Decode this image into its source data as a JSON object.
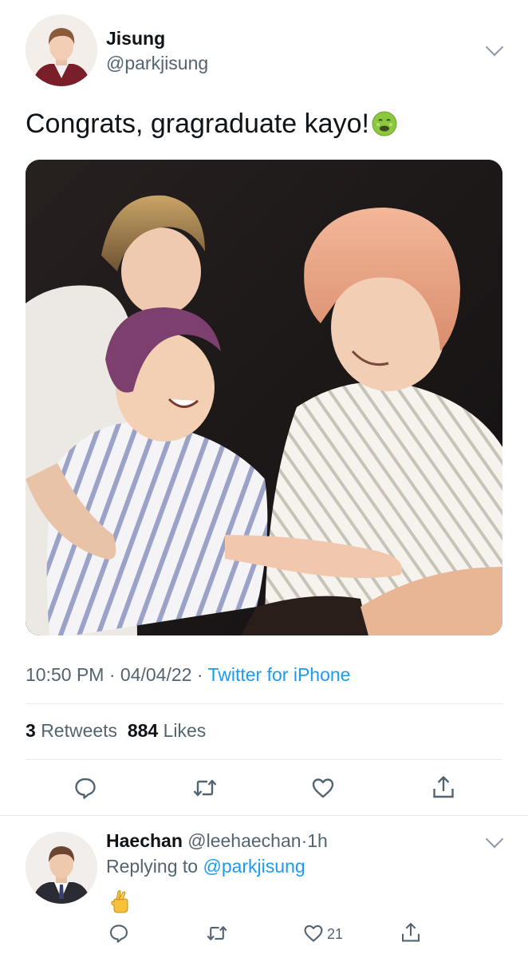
{
  "tweet": {
    "author_name": "Jisung",
    "author_handle": "@parkjisung",
    "text": "Congrats, gragraduate kayo!",
    "text_emoji": "nauseated-face-icon",
    "time": "10:50 PM",
    "date": "04/04/22",
    "source": "Twitter for iPhone",
    "retweet_count": "3",
    "retweets_label": "Retweets",
    "like_count": "884",
    "likes_label": "Likes"
  },
  "reply": {
    "author_name": "Haechan",
    "author_handle": "@leehaechan",
    "time": "1h",
    "replying_label": "Replying to",
    "replying_to": "@parkjisung",
    "content_emoji": "crossed-fingers-icon",
    "like_count": "21"
  },
  "colors": {
    "link": "#1d9bf0",
    "secondary_text": "#536471",
    "primary_text": "#0f1419",
    "divider": "#e6ebef"
  }
}
